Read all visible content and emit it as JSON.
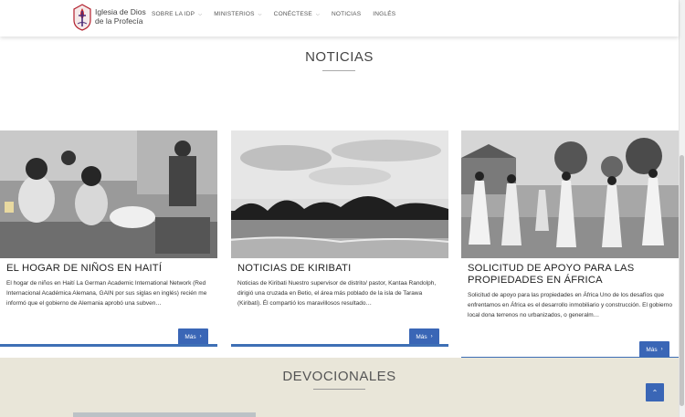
{
  "header": {
    "brand_line1": "Iglesia de Dios",
    "brand_line2": "de la Profecía",
    "nav": [
      {
        "label": "SOBRE LA IDP",
        "has_dropdown": true
      },
      {
        "label": "MINISTERIOS",
        "has_dropdown": true
      },
      {
        "label": "CONÉCTESE",
        "has_dropdown": true
      },
      {
        "label": "NOTICIAS",
        "has_dropdown": false
      },
      {
        "label": "INGLÉS",
        "has_dropdown": false
      }
    ]
  },
  "news": {
    "section_title": "NOTICIAS",
    "cards": [
      {
        "title": "EL HOGAR DE NIÑOS EN HAITÍ",
        "excerpt": "El hogar de niños en Haití La German Academic International Network (Red Internacional Académica Alemana, GAIN por sus siglas en inglés) recién me informó que el gobierno de Alemania aprobó una subven…",
        "button": "Más",
        "image": "children-classroom-photo"
      },
      {
        "title": "NOTICIAS DE KIRIBATI",
        "excerpt": "Noticias de Kiribati Nuestro supervisor de distrito/ pastor, Kantaa Randolph, dirigió una cruzada en Betio, el área más poblado de la isla de Tarawa (Kiribati). Él compartió los maravillosos resultado…",
        "button": "Más",
        "image": "island-beach-photo"
      },
      {
        "title": "SOLICITUD DE APOYO PARA LAS PROPIEDADES EN ÁFRICA",
        "excerpt": "Solicitud de apoyo para las propiedades en África Uno de los desafíos que enfrentamos en África es el desarrollo inmobiliario y construcción. El gobierno local dona terrenos no urbanizados, o generalm…",
        "button": "Más",
        "image": "women-dancing-photo"
      }
    ]
  },
  "devotionals": {
    "section_title": "DEVOCIONALES"
  },
  "icons": {
    "chevron": "chevron-down-icon",
    "arrow": "chevron-right-icon",
    "totop": "chevron-up-icon"
  },
  "colors": {
    "accent": "#3a66b6",
    "devo_bg": "#e9e6d9"
  }
}
